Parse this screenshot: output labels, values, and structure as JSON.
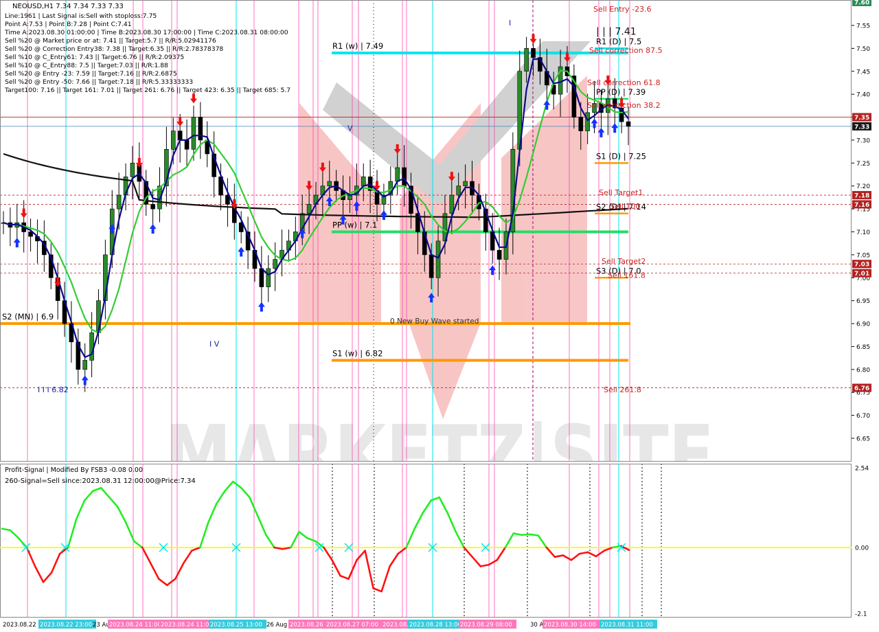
{
  "symbol_header": "NEOUSD,H1  7.34 7.34 7.33 7.33",
  "info_lines": [
    "Line:1961 | Last Signal is:Sell with stoploss:7.75",
    "Point A:7.53 | Point B:7.28 | Point C:7.41",
    "Time A:2023.08.30 01:00:00 | Time B:2023.08.30 17:00:00 | Time C:2023.08.31 08:00:00",
    "Sell %20 @ Market price or at: 7.41 || Target:5.7 || R/R:5.02941176",
    "Sell %20 @ Correction Entry38: 7.38 || Target:6.35 || R/R:2.78378378",
    "Sell %10 @ C_Entry61: 7.43 || Target:6.76 || R/R:2.09375",
    "Sell %10 @ C_Entry88: 7.5 || Target:7.03 || R/R:1.88",
    "Sell %20 @ Entry -23: 7.59 || Target:7.16 || R/R:2.6875",
    "Sell %20 @ Entry -50: 7.66 || Target:7.18 || R/R:5.33333333",
    "Target100: 7.16 || Target 161: 7.01 || Target 261: 6.76 || Target 423: 6.35 || Target 685: 5.7"
  ],
  "watermark": "MARKETZ|SITE",
  "colors": {
    "accent_cyan": "#00e5ee",
    "ma_green": "#33cc33",
    "ma_navy": "#0a0a8c",
    "ma_black": "#111111",
    "level_orange": "#ff9900",
    "signal_red": "#ff0000",
    "pink_vline": "#ff33aa",
    "price_tag_red": "#b22222",
    "price_tag_dark": "#1a1a1a",
    "zero_line_yellow": "#ffff00"
  },
  "chart_data": [
    {
      "type": "candlestick",
      "title": "NEOUSD,H1",
      "ylim": [
        6.6,
        7.62
      ],
      "y_ticks": [
        "7.55",
        "7.50",
        "7.45",
        "7.40",
        "7.35",
        "7.30",
        "7.25",
        "7.20",
        "7.15",
        "7.10",
        "7.05",
        "7.00",
        "6.95",
        "6.90",
        "6.85",
        "6.80",
        "6.75",
        "6.70",
        "6.65"
      ],
      "price_tags": [
        {
          "label": "7.60",
          "price": 7.605,
          "color": "#2e8b57"
        },
        {
          "label": "7.35",
          "price": 7.35,
          "color": "#b22222"
        },
        {
          "label": "7.33",
          "price": 7.33,
          "color": "#1a1a1a"
        },
        {
          "label": "7.18",
          "price": 7.18,
          "color": "#b22222"
        },
        {
          "label": "7.16",
          "price": 7.16,
          "color": "#b22222"
        },
        {
          "label": "7.03",
          "price": 7.03,
          "color": "#b22222"
        },
        {
          "label": "7.01",
          "price": 7.01,
          "color": "#b22222"
        },
        {
          "label": "6.76",
          "price": 6.76,
          "color": "#b22222"
        }
      ],
      "close_series": [
        7.12,
        7.11,
        7.12,
        7.1,
        7.09,
        7.08,
        7.05,
        7.0,
        6.95,
        6.9,
        6.86,
        6.8,
        6.82,
        6.88,
        6.95,
        7.05,
        7.15,
        7.18,
        7.22,
        7.25,
        7.21,
        7.16,
        7.15,
        7.2,
        7.28,
        7.32,
        7.3,
        7.28,
        7.35,
        7.3,
        7.27,
        7.22,
        7.18,
        7.16,
        7.12,
        7.1,
        7.06,
        7.02,
        6.98,
        7.02,
        7.04,
        7.06,
        7.08,
        7.1,
        7.14,
        7.16,
        7.18,
        7.2,
        7.21,
        7.19,
        7.17,
        7.18,
        7.2,
        7.22,
        7.19,
        7.16,
        7.18,
        7.21,
        7.24,
        7.2,
        7.14,
        7.1,
        7.05,
        7.0,
        7.08,
        7.14,
        7.18,
        7.2,
        7.21,
        7.18,
        7.15,
        7.1,
        7.06,
        7.04,
        7.1,
        7.28,
        7.45,
        7.5,
        7.48,
        7.45,
        7.42,
        7.4,
        7.46,
        7.44,
        7.35,
        7.32,
        7.36,
        7.38,
        7.36,
        7.39,
        7.37,
        7.34,
        7.33
      ],
      "levels": [
        {
          "label": "R1 (w) | 7.49",
          "price": 7.49,
          "color": "#00e5ee"
        },
        {
          "label": "PP (w) | 7.1",
          "price": 7.1,
          "color": "#22dd66"
        },
        {
          "label": "S1 (w) | 6.82",
          "price": 6.82,
          "color": "#ff9900"
        },
        {
          "label": "S2 (MN) | 6.9",
          "price": 6.9,
          "color": "#ff9900"
        },
        {
          "label": "R1 (D) | 7.5",
          "price": 7.5,
          "color": "#00e5ee"
        },
        {
          "label": "PP (D) | 7.39",
          "price": 7.39,
          "color": "#22dd66"
        },
        {
          "label": "S1 (D) | 7.25",
          "price": 7.25,
          "color": "#ff9900"
        },
        {
          "label": "S2 (D) | 7.14",
          "price": 7.14,
          "color": "#ff9900"
        },
        {
          "label": "S3 (D) | 7.0",
          "price": 7.0,
          "color": "#ff9900"
        }
      ],
      "annotations": [
        {
          "text": "Sell Entry -23.6",
          "price": 7.58,
          "color": "#cc2222"
        },
        {
          "text": "| | | 7.41",
          "price": 7.53,
          "color": "#111111"
        },
        {
          "text": "Sell correction 87.5",
          "price": 7.49,
          "color": "#cc2222"
        },
        {
          "text": "Sell correction 61.8",
          "price": 7.42,
          "color": "#cc2222"
        },
        {
          "text": "Sell correction 38.2",
          "price": 7.37,
          "color": "#cc2222"
        },
        {
          "text": "Sell Target1",
          "price": 7.18,
          "color": "#cc2222"
        },
        {
          "text": "Sell 100",
          "price": 7.15,
          "color": "#cc2222"
        },
        {
          "text": "Sell Target2",
          "price": 7.03,
          "color": "#cc2222"
        },
        {
          "text": "Sell 161.8",
          "price": 7.0,
          "color": "#cc2222"
        },
        {
          "text": "Sell 261.8",
          "price": 6.75,
          "color": "#cc2222"
        },
        {
          "text": "0 New Buy Wave started",
          "price": 6.9,
          "color": "#333333"
        },
        {
          "text": "I V",
          "price": 6.85,
          "color": "#1a1aaa"
        },
        {
          "text": "I I I 6.82",
          "price": 6.75,
          "color": "#1a1aaa"
        },
        {
          "text": "V",
          "price": 7.32,
          "color": "#1a1aaa"
        },
        {
          "text": "I",
          "price": 7.55,
          "color": "#1a1aaa"
        }
      ]
    },
    {
      "type": "line",
      "title": "Profit-Signal | Modified By FSB3 -0.08 0.00",
      "subtitle": "260-Signal=Sell since:2023.08.31 12:00:00@Price:7.34",
      "ylim": [
        -2.1,
        2.54
      ],
      "y_ticks": [
        "2.54",
        "0.00",
        "-2.1"
      ],
      "series_points": [
        0.6,
        0.55,
        0.3,
        0,
        -0.6,
        -1.1,
        -0.8,
        -0.2,
        0,
        0.9,
        1.5,
        1.8,
        1.9,
        1.6,
        1.3,
        0.8,
        0.2,
        0,
        -0.5,
        -1.0,
        -1.2,
        -1.0,
        -0.5,
        -0.1,
        0,
        0.8,
        1.4,
        1.8,
        2.1,
        1.9,
        1.6,
        1.0,
        0.4,
        0,
        -0.05,
        0,
        0.5,
        0.3,
        0.2,
        0,
        -0.4,
        -0.9,
        -1.0,
        -0.4,
        -0.1,
        -1.3,
        -1.4,
        -0.6,
        -0.2,
        0,
        0.6,
        1.1,
        1.5,
        1.6,
        1.1,
        0.5,
        0,
        -0.3,
        -0.6,
        -0.55,
        -0.4,
        0,
        0.45,
        0.4,
        0.42,
        0.38,
        0,
        -0.3,
        -0.25,
        -0.4,
        -0.2,
        -0.15,
        -0.28,
        -0.1,
        0,
        0.05,
        -0.08
      ]
    }
  ],
  "x_axis_labels": [
    "2023.08.22 06:00",
    "2023.08.22 23:00",
    "23 Aug",
    "2023.08.24 11:00",
    "2023.08.24 11:00",
    "2023.08.25 13:00",
    "26 Aug",
    "2023.08.26 21:00",
    "2023.08.27 07:00",
    "2023.08.28 02:00",
    "2023.08.28 13:00",
    "2023.08.29 08:00",
    "30 Aug",
    "2023.08.30 14:00",
    "2023.08.31 11:00"
  ]
}
